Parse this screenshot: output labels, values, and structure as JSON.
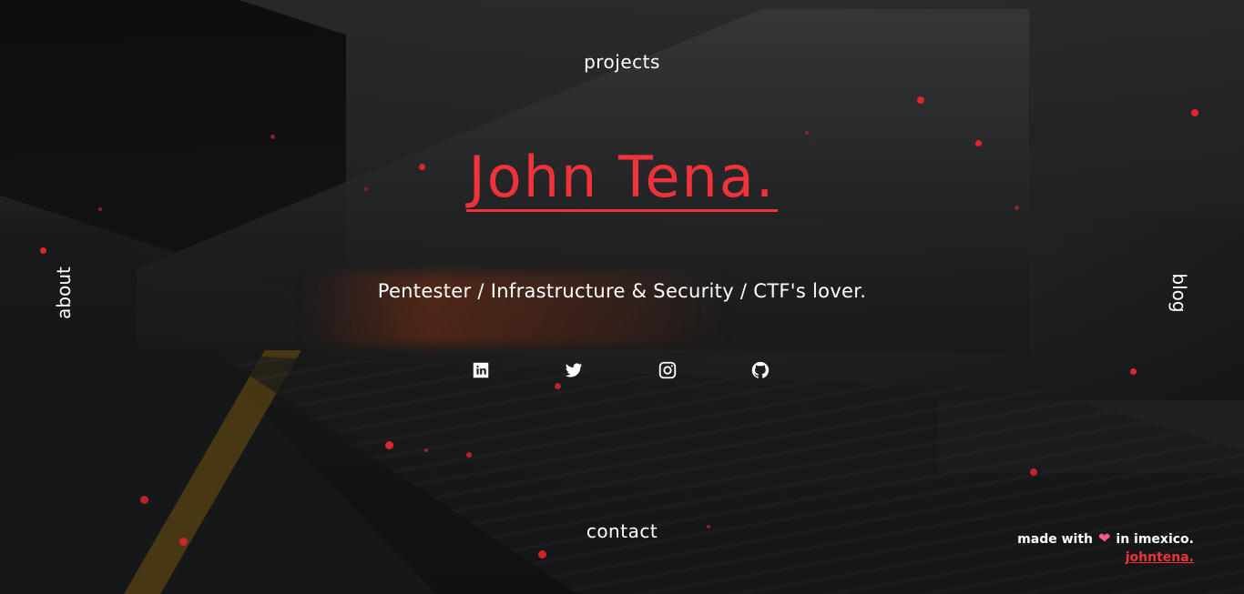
{
  "nav": {
    "top_label": "projects",
    "left_label": "about",
    "right_label": "blog",
    "bottom_label": "contact"
  },
  "hero": {
    "name": "John Tena",
    "name_dot": ".",
    "tagline": "Pentester / Infrastructure & Security / CTF's lover."
  },
  "socials": [
    {
      "icon": "linkedin-icon"
    },
    {
      "icon": "twitter-icon"
    },
    {
      "icon": "instagram-icon"
    },
    {
      "icon": "github-icon"
    }
  ],
  "footer": {
    "made_with": "made with",
    "location": "in imexico.",
    "link_text": "johntena."
  },
  "colors": {
    "accent": "#f0323a",
    "text": "#ffffff",
    "heart": "#ff5b8a",
    "background": "#1b1c1e"
  }
}
